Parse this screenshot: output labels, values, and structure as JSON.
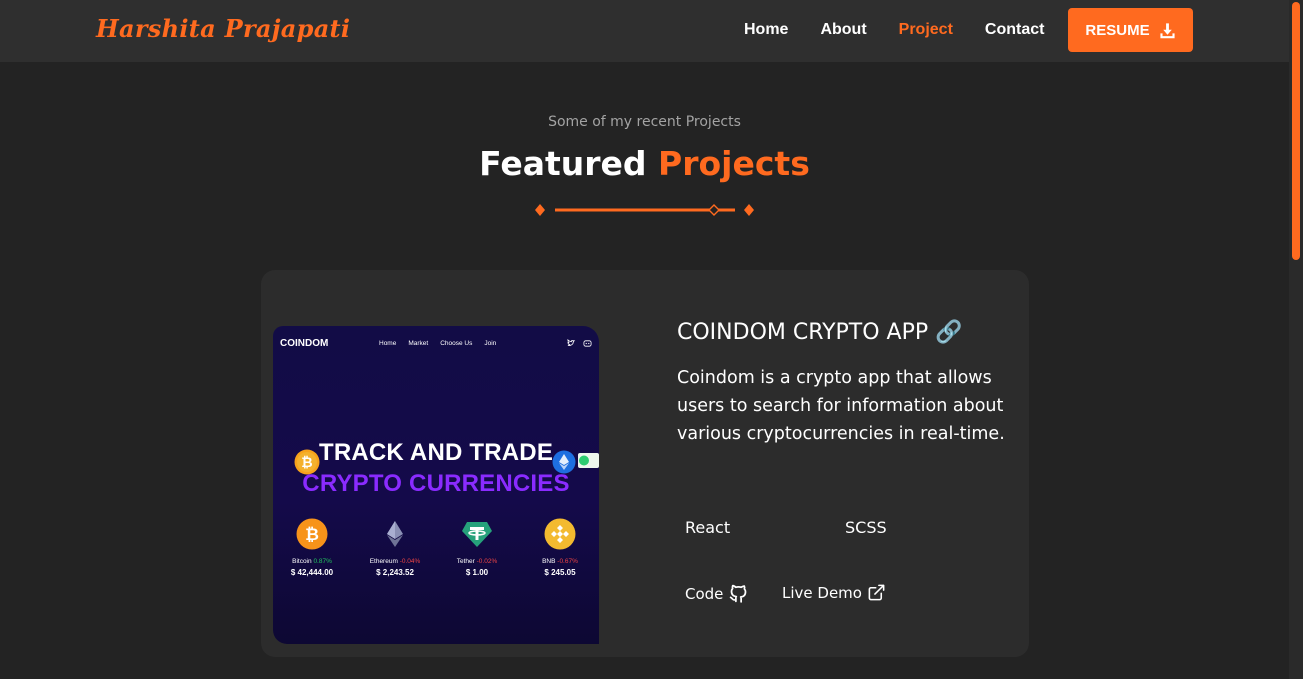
{
  "navbar": {
    "logo": "Harshita Prajapati",
    "links": [
      "Home",
      "About",
      "Project",
      "Contact"
    ],
    "active": "Project",
    "resume_label": "RESUME",
    "resume_icon": "download-icon"
  },
  "section": {
    "subtitle": "Some of my recent Projects",
    "title_main": "Featured",
    "title_accent": "Projects"
  },
  "project": {
    "title": "COINDOM CRYPTO APP 🔗",
    "description": "Coindom is a crypto app that allows users to search for information about various cryptocurrencies in real-time.",
    "tags": [
      "React",
      "SCSS"
    ],
    "code_label": "Code",
    "code_icon": "github-icon",
    "demo_label": "Live Demo",
    "demo_icon": "external-link-icon",
    "screenshot": {
      "logo": "COINDOM",
      "nav": [
        "Home",
        "Market",
        "Choose Us",
        "Join"
      ],
      "headline_1": "TRACK AND TRADE",
      "headline_2": "CRYPTO CURRENCIES",
      "coins": [
        {
          "name": "Bitcoin",
          "change": "0.87%",
          "price": "$ 42,444.00",
          "up": true
        },
        {
          "name": "Ethereum",
          "change": "-0.04%",
          "price": "$ 2,243.52",
          "up": false
        },
        {
          "name": "Tether",
          "change": "-0.02%",
          "price": "$ 1.00",
          "up": false
        },
        {
          "name": "BNB",
          "change": "-0.67%",
          "price": "$ 245.05",
          "up": false
        }
      ]
    }
  },
  "colors": {
    "accent": "#ff6a1f",
    "background": "#232323",
    "card": "#2c2c2c"
  }
}
